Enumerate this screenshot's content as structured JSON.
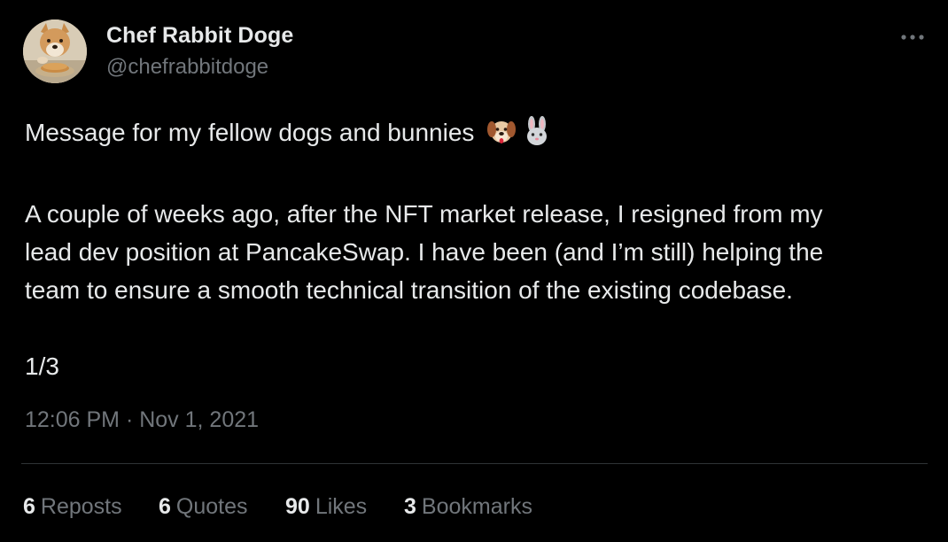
{
  "author": {
    "display_name": "Chef Rabbit Doge",
    "handle": "@chefrabbitdoge"
  },
  "more_icon": "ellipsis-icon",
  "tweet": {
    "line1_text": "Message for my fellow dogs and bunnies",
    "line1_emojis": [
      "dog-face-emoji",
      "rabbit-face-emoji"
    ],
    "paragraph2_line1": "A couple of weeks ago, after the NFT market release, I resigned from my",
    "paragraph2_line2": "lead dev position at PancakeSwap. I have been (and I’m still) helping the",
    "paragraph2_line3": "team to ensure a smooth technical transition of the existing codebase.",
    "thread_counter": "1/3"
  },
  "timestamp": "12:06 PM · Nov 1, 2021",
  "stats": {
    "reposts": {
      "count": "6",
      "label": "Reposts"
    },
    "quotes": {
      "count": "6",
      "label": "Quotes"
    },
    "likes": {
      "count": "90",
      "label": "Likes"
    },
    "bookmarks": {
      "count": "3",
      "label": "Bookmarks"
    }
  },
  "colors": {
    "background": "#000000",
    "text_primary": "#e7e9ea",
    "text_secondary": "#71767b",
    "divider": "#2f3336"
  }
}
